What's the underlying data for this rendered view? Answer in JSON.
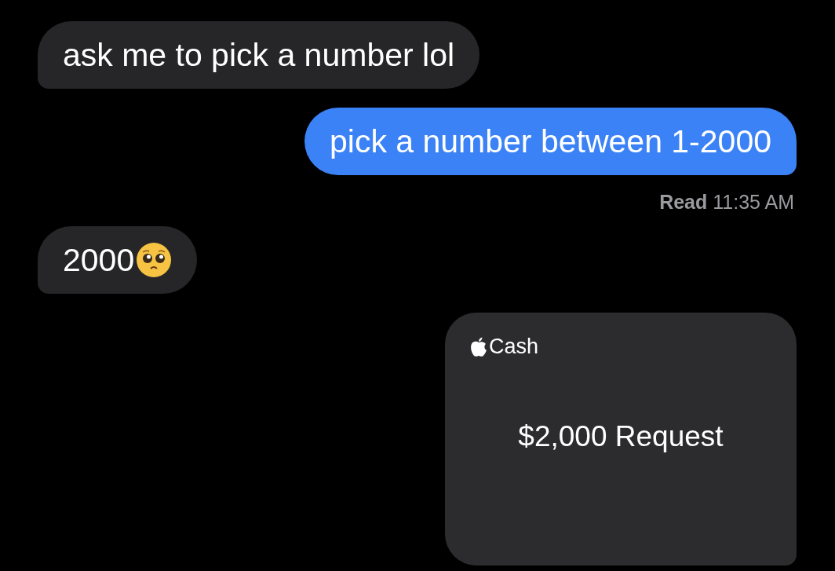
{
  "messages": [
    {
      "kind": "text",
      "sent": false,
      "text": "ask me to pick a number lol"
    },
    {
      "kind": "text",
      "sent": true,
      "text": "pick a number between 1-2000",
      "receipt": "**Read** 11:35 AM"
    },
    {
      "kind": "text",
      "sent": false,
      "text": "2000",
      "emoji": true
    },
    {
      "kind": "payment",
      "sent": true,
      "brand": "Cash",
      "amount": "$2,000 Request"
    }
  ]
}
